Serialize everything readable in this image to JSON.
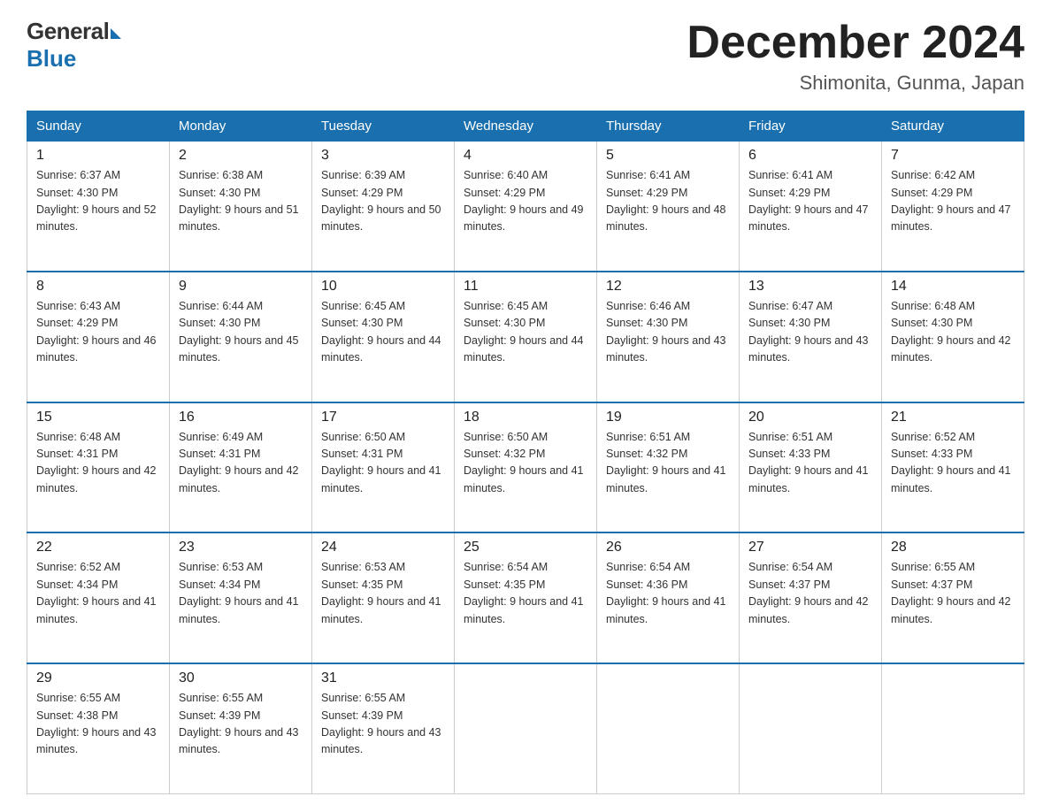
{
  "header": {
    "logo_general": "General",
    "logo_blue": "Blue",
    "month_title": "December 2024",
    "location": "Shimonita, Gunma, Japan"
  },
  "calendar": {
    "days_of_week": [
      "Sunday",
      "Monday",
      "Tuesday",
      "Wednesday",
      "Thursday",
      "Friday",
      "Saturday"
    ],
    "weeks": [
      [
        {
          "day": "1",
          "sunrise": "6:37 AM",
          "sunset": "4:30 PM",
          "daylight": "9 hours and 52 minutes."
        },
        {
          "day": "2",
          "sunrise": "6:38 AM",
          "sunset": "4:30 PM",
          "daylight": "9 hours and 51 minutes."
        },
        {
          "day": "3",
          "sunrise": "6:39 AM",
          "sunset": "4:29 PM",
          "daylight": "9 hours and 50 minutes."
        },
        {
          "day": "4",
          "sunrise": "6:40 AM",
          "sunset": "4:29 PM",
          "daylight": "9 hours and 49 minutes."
        },
        {
          "day": "5",
          "sunrise": "6:41 AM",
          "sunset": "4:29 PM",
          "daylight": "9 hours and 48 minutes."
        },
        {
          "day": "6",
          "sunrise": "6:41 AM",
          "sunset": "4:29 PM",
          "daylight": "9 hours and 47 minutes."
        },
        {
          "day": "7",
          "sunrise": "6:42 AM",
          "sunset": "4:29 PM",
          "daylight": "9 hours and 47 minutes."
        }
      ],
      [
        {
          "day": "8",
          "sunrise": "6:43 AM",
          "sunset": "4:29 PM",
          "daylight": "9 hours and 46 minutes."
        },
        {
          "day": "9",
          "sunrise": "6:44 AM",
          "sunset": "4:30 PM",
          "daylight": "9 hours and 45 minutes."
        },
        {
          "day": "10",
          "sunrise": "6:45 AM",
          "sunset": "4:30 PM",
          "daylight": "9 hours and 44 minutes."
        },
        {
          "day": "11",
          "sunrise": "6:45 AM",
          "sunset": "4:30 PM",
          "daylight": "9 hours and 44 minutes."
        },
        {
          "day": "12",
          "sunrise": "6:46 AM",
          "sunset": "4:30 PM",
          "daylight": "9 hours and 43 minutes."
        },
        {
          "day": "13",
          "sunrise": "6:47 AM",
          "sunset": "4:30 PM",
          "daylight": "9 hours and 43 minutes."
        },
        {
          "day": "14",
          "sunrise": "6:48 AM",
          "sunset": "4:30 PM",
          "daylight": "9 hours and 42 minutes."
        }
      ],
      [
        {
          "day": "15",
          "sunrise": "6:48 AM",
          "sunset": "4:31 PM",
          "daylight": "9 hours and 42 minutes."
        },
        {
          "day": "16",
          "sunrise": "6:49 AM",
          "sunset": "4:31 PM",
          "daylight": "9 hours and 42 minutes."
        },
        {
          "day": "17",
          "sunrise": "6:50 AM",
          "sunset": "4:31 PM",
          "daylight": "9 hours and 41 minutes."
        },
        {
          "day": "18",
          "sunrise": "6:50 AM",
          "sunset": "4:32 PM",
          "daylight": "9 hours and 41 minutes."
        },
        {
          "day": "19",
          "sunrise": "6:51 AM",
          "sunset": "4:32 PM",
          "daylight": "9 hours and 41 minutes."
        },
        {
          "day": "20",
          "sunrise": "6:51 AM",
          "sunset": "4:33 PM",
          "daylight": "9 hours and 41 minutes."
        },
        {
          "day": "21",
          "sunrise": "6:52 AM",
          "sunset": "4:33 PM",
          "daylight": "9 hours and 41 minutes."
        }
      ],
      [
        {
          "day": "22",
          "sunrise": "6:52 AM",
          "sunset": "4:34 PM",
          "daylight": "9 hours and 41 minutes."
        },
        {
          "day": "23",
          "sunrise": "6:53 AM",
          "sunset": "4:34 PM",
          "daylight": "9 hours and 41 minutes."
        },
        {
          "day": "24",
          "sunrise": "6:53 AM",
          "sunset": "4:35 PM",
          "daylight": "9 hours and 41 minutes."
        },
        {
          "day": "25",
          "sunrise": "6:54 AM",
          "sunset": "4:35 PM",
          "daylight": "9 hours and 41 minutes."
        },
        {
          "day": "26",
          "sunrise": "6:54 AM",
          "sunset": "4:36 PM",
          "daylight": "9 hours and 41 minutes."
        },
        {
          "day": "27",
          "sunrise": "6:54 AM",
          "sunset": "4:37 PM",
          "daylight": "9 hours and 42 minutes."
        },
        {
          "day": "28",
          "sunrise": "6:55 AM",
          "sunset": "4:37 PM",
          "daylight": "9 hours and 42 minutes."
        }
      ],
      [
        {
          "day": "29",
          "sunrise": "6:55 AM",
          "sunset": "4:38 PM",
          "daylight": "9 hours and 43 minutes."
        },
        {
          "day": "30",
          "sunrise": "6:55 AM",
          "sunset": "4:39 PM",
          "daylight": "9 hours and 43 minutes."
        },
        {
          "day": "31",
          "sunrise": "6:55 AM",
          "sunset": "4:39 PM",
          "daylight": "9 hours and 43 minutes."
        },
        null,
        null,
        null,
        null
      ]
    ]
  }
}
